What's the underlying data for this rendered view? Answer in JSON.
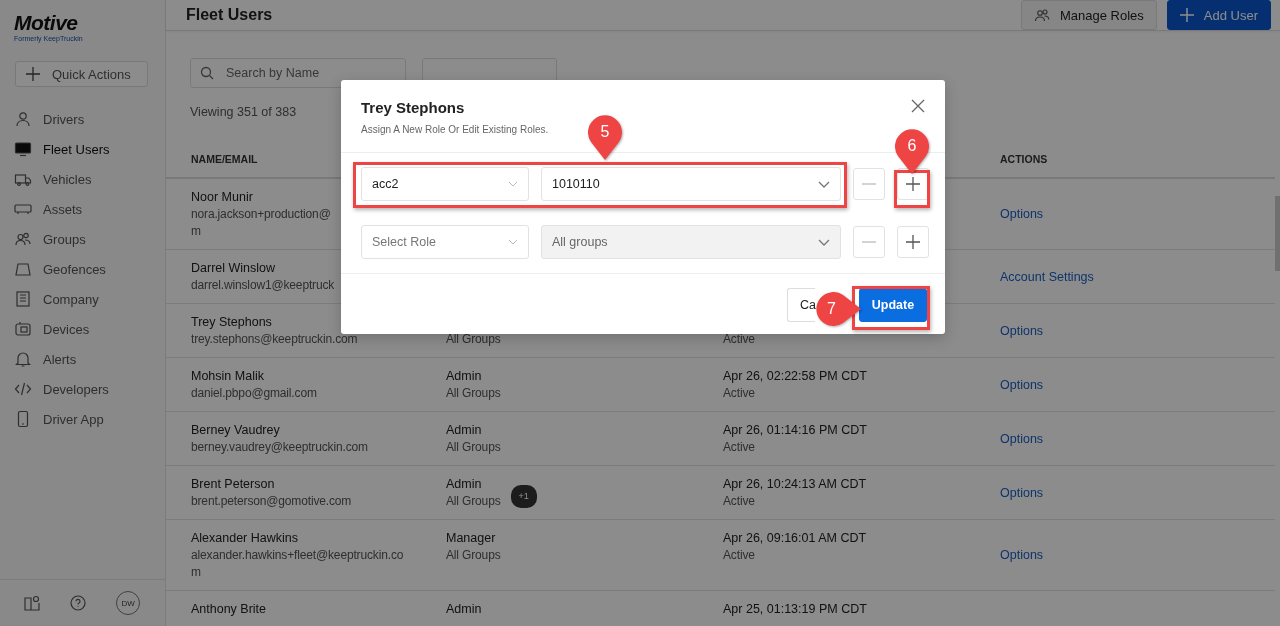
{
  "sidebar": {
    "logo": "Motive",
    "logo_subtitle": "Formerly KeepTruckin",
    "quick_action": "Quick Actions",
    "items": [
      {
        "label": "Drivers",
        "selected": false
      },
      {
        "label": "Fleet Users",
        "selected": true
      },
      {
        "label": "Vehicles",
        "selected": false
      },
      {
        "label": "Assets",
        "selected": false
      },
      {
        "label": "Groups",
        "selected": false
      },
      {
        "label": "Geofences",
        "selected": false
      },
      {
        "label": "Company",
        "selected": false
      },
      {
        "label": "Devices",
        "selected": false
      },
      {
        "label": "Alerts",
        "selected": false
      },
      {
        "label": "Developers",
        "selected": false
      },
      {
        "label": "Driver App",
        "selected": false
      }
    ],
    "avatar": "DW"
  },
  "header": {
    "title": "Fleet Users",
    "buttons": [
      {
        "label": "Manage Roles",
        "kind": "secondary"
      },
      {
        "label": "Add User",
        "kind": "primary"
      }
    ]
  },
  "toolbar": {
    "search": {
      "placeholder": "Search by Name"
    },
    "count": "Viewing 351 of 383"
  },
  "table": {
    "columns": {
      "name_email": "NAME/EMAIL",
      "actions": "ACTIONS"
    },
    "rows": [
      {
        "name": "Noor Munir",
        "email": [
          "nora.jackson+production@",
          "m"
        ],
        "action": "Options"
      },
      {
        "name": "Darrel Winslow",
        "email": [
          "darrel.winslow1@keeptruck"
        ],
        "action": "Account Settings"
      },
      {
        "name": "Trey Stephons",
        "email": [
          "trey.stephons@keeptruckin.com"
        ],
        "groups": "All Groups",
        "status": "Active",
        "action": "Options"
      },
      {
        "name": "Mohsin Malik",
        "email": [
          "daniel.pbpo@gmail.com"
        ],
        "role": "Admin",
        "groups": "All Groups",
        "last_active": "Apr 26, 02:22:58 PM CDT",
        "status": "Active",
        "action": "Options"
      },
      {
        "name": "Berney Vaudrey",
        "email": [
          "berney.vaudrey@keeptruckin.com"
        ],
        "role": "Admin",
        "groups": "All Groups",
        "last_active": "Apr 26, 01:14:16 PM CDT",
        "status": "Active",
        "action": "Options"
      },
      {
        "name": "Brent Peterson",
        "email": [
          "brent.peterson@gomotive.com"
        ],
        "role": "Admin",
        "groups": "All Groups",
        "badge": "+1",
        "last_active": "Apr 26, 10:24:13 AM CDT",
        "status": "Active",
        "action": "Options"
      },
      {
        "name": "Alexander Hawkins",
        "email": [
          "alexander.hawkins+fleet@keeptruckin.co",
          "m"
        ],
        "role": "Manager",
        "groups": "All Groups",
        "last_active": "Apr 26, 09:16:01 AM CDT",
        "status": "Active",
        "action": "Options"
      },
      {
        "name": "Anthony Brite",
        "email": [],
        "role": "Admin",
        "last_active": "Apr 25, 01:13:19 PM CDT"
      }
    ]
  },
  "dialog": {
    "title": "Trey Stephons",
    "subtitle": "Assign A New Role Or Edit Existing Roles.",
    "rows": [
      {
        "role": {
          "value": "acc2"
        },
        "groups": {
          "value": "1010110",
          "disabled": false
        }
      },
      {
        "role": {
          "placeholder": "Select Role"
        },
        "groups": {
          "value": "All groups",
          "disabled": true
        }
      }
    ],
    "buttons": [
      {
        "label": "Ca",
        "kind": "secondary"
      },
      {
        "label": "Update",
        "kind": "primary"
      }
    ]
  },
  "annotations": [
    {
      "number": "5",
      "kind": "down"
    },
    {
      "number": "6",
      "kind": "down"
    },
    {
      "number": "7",
      "kind": "right"
    }
  ]
}
